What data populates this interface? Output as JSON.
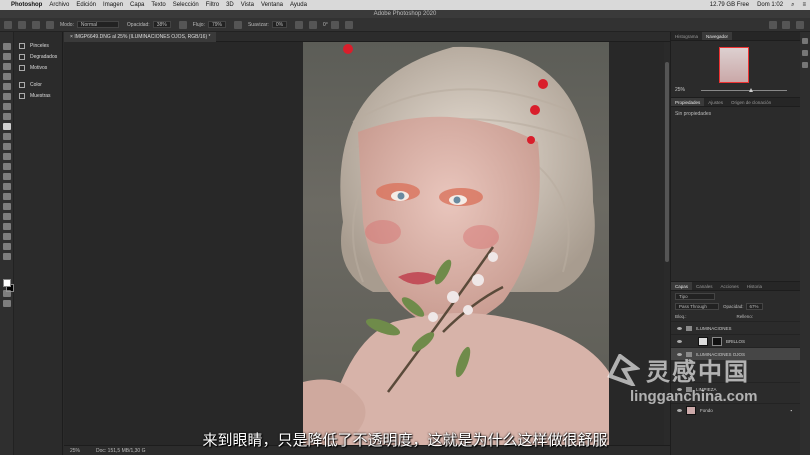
{
  "menubar": {
    "app": "Photoshop",
    "items": [
      "Archivo",
      "Edición",
      "Imagen",
      "Capa",
      "Texto",
      "Selección",
      "Filtro",
      "3D",
      "Vista",
      "Ventana",
      "Ayuda"
    ],
    "status": {
      "disk": "12.79 GB Free",
      "clock": "Dom 1:02"
    }
  },
  "titlebar": {
    "title": "Adobe Photoshop 2020"
  },
  "options": {
    "mode_label": "Modo:",
    "mode_value": "Normal",
    "opacity_label": "Opacidad:",
    "opacity_value": "38%",
    "flow_label": "Flujo:",
    "flow_value": "79%",
    "smooth_label": "Suavizar:",
    "smooth_value": "0%",
    "angle": "0°"
  },
  "left_panel": {
    "items": [
      {
        "label": "Pinceles"
      },
      {
        "label": "Degradados"
      },
      {
        "label": "Motivos"
      },
      {
        "label": "Color"
      },
      {
        "label": "Muestras"
      }
    ]
  },
  "document": {
    "tab_title": "IMGP6649.DNG al 25% (ILUMINACIONES OJOS, RGB/16) *"
  },
  "status": {
    "zoom": "25%",
    "doc_size": "Doc: 151,5 MB/1,30 G"
  },
  "right_panels": {
    "nav_tabs": [
      "Histograma",
      "Navegador"
    ],
    "nav_zoom": "25%",
    "props_tabs": [
      "Propiedades",
      "Ajustes",
      "Origen de clonación"
    ],
    "props_text": "Sin propiedades",
    "layer_tabs": [
      "Capas",
      "Canales",
      "Acciones",
      "Historia"
    ],
    "kind_filter": "Tipo",
    "blend_mode": "Pass Through",
    "opacity_label": "Opacidad:",
    "opacity_value": "67%",
    "lock_label": "Bloq.:",
    "fill_label": "Relleno:",
    "layers": [
      {
        "name": "ILUMINACIONES"
      },
      {
        "name": "BRILLOS"
      },
      {
        "name": "ILUMINACIONES OJOS"
      },
      {
        "name": "LIMPIEZA"
      },
      {
        "name": "Fondo"
      }
    ]
  },
  "subtitle": "来到眼睛，只是降低了不透明度，这就是为什么这样做很舒服",
  "watermark": {
    "cn": "灵感中国",
    "en": "lingganchina.com"
  },
  "colors": {
    "ui_bg": "#2b2b2b",
    "menubar": "#d9d9d9",
    "selection_frame": "#ee3333"
  }
}
